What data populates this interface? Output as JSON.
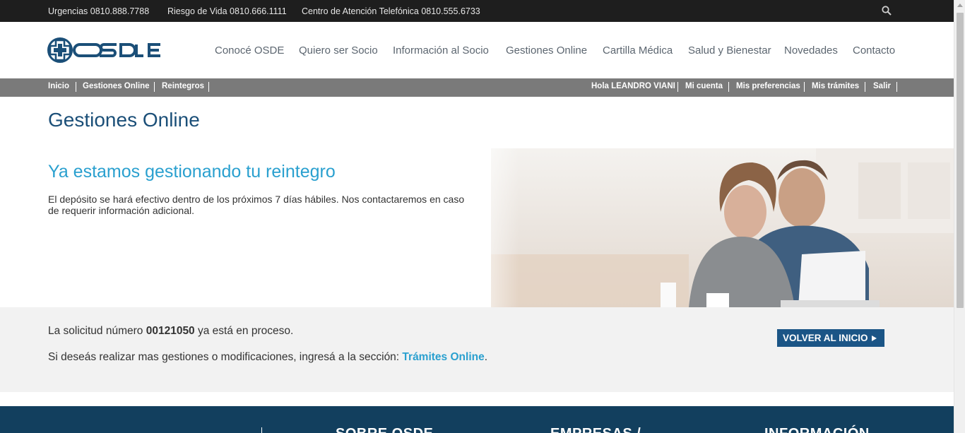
{
  "topbar": {
    "urgencias": "Urgencias 0810.888.7788",
    "riesgo": "Riesgo de Vida 0810.666.1111",
    "centro": "Centro de Atención Telefónica 0810.555.6733",
    "search_icon": "search-icon"
  },
  "header": {
    "logo_text": "OSDE",
    "nav": [
      "Conocé OSDE",
      "Quiero ser Socio",
      "Información al Socio",
      "Gestiones Online",
      "Cartilla Médica",
      "Salud y Bienestar",
      "Novedades",
      "Contacto"
    ]
  },
  "breadcrumb": {
    "items": [
      "Inicio",
      "Gestiones Online",
      "Reintegros"
    ]
  },
  "user_menu": {
    "greeting": "Hola LEANDRO VIANI",
    "mi_cuenta": "Mi cuenta",
    "preferencias": "Mis preferencias",
    "tramites": "Mis trámites",
    "salir": "Salir"
  },
  "page": {
    "title": "Gestiones Online"
  },
  "hero": {
    "title": "Ya estamos gestionando tu reintegro",
    "text": "El depósito se hará efectivo dentro de los próximos 7 días hábiles. Nos contactaremos en caso de requerir información adicional."
  },
  "status": {
    "line1_prefix": "La solicitud número ",
    "request_number": "00121050",
    "line1_suffix": " ya está en proceso.",
    "line2_prefix": "Si deseás realizar mas gestiones o modificaciones, ingresá a la sección: ",
    "link": "Trámites Online",
    "line2_suffix": ".",
    "button": "VOLVER AL INICIO"
  },
  "footer": {
    "sections": [
      "SOBRE OSDE",
      "EMPRESAS /",
      "INFORMACIÓN"
    ]
  },
  "colors": {
    "brand_dark": "#1b4f78",
    "accent": "#2aa0cf",
    "button": "#1b5586",
    "footer": "#123f5e"
  }
}
